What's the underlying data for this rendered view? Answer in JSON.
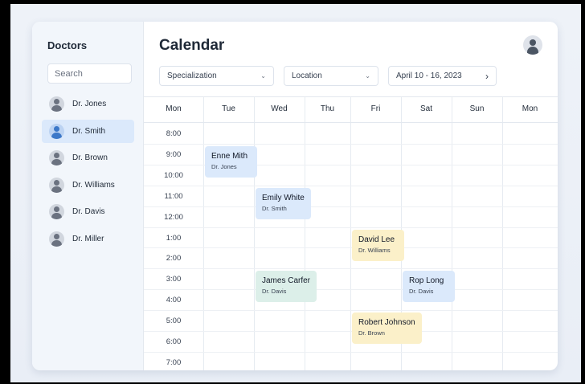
{
  "sidebar": {
    "title": "Doctors",
    "search_placeholder": "Search",
    "doctors": [
      {
        "name": "Dr. Jones",
        "active": false
      },
      {
        "name": "Dr. Smith",
        "active": true
      },
      {
        "name": "Dr. Brown",
        "active": false
      },
      {
        "name": "Dr. Williams",
        "active": false
      },
      {
        "name": "Dr. Davis",
        "active": false
      },
      {
        "name": "Dr. Miller",
        "active": false
      }
    ]
  },
  "header": {
    "title": "Calendar",
    "filters": {
      "specialization": "Specialization",
      "location": "Location",
      "date_range": "April 10 - 16, 2023"
    }
  },
  "calendar": {
    "days": [
      "Mon",
      "Tue",
      "Wed",
      "Thu",
      "Fri",
      "Sat",
      "Sun",
      "Mon"
    ],
    "times": [
      "8:00",
      "9:00",
      "10:00",
      "11:00",
      "12:00",
      "1:00",
      "2:00",
      "3:00",
      "4:00",
      "5:00",
      "6:00",
      "7:00"
    ],
    "appointments": [
      {
        "patient": "Enne Mith",
        "doctor": "Dr. Jones",
        "day_index": 1,
        "time": "9:00",
        "color": "blue"
      },
      {
        "patient": "Emily White",
        "doctor": "Dr. Smith",
        "day_index": 2,
        "time": "11:00",
        "color": "blue"
      },
      {
        "patient": "David Lee",
        "doctor": "Dr. Williams",
        "day_index": 4,
        "time": "1:00",
        "color": "yellow"
      },
      {
        "patient": "James Carfer",
        "doctor": "Dr. Davis",
        "day_index": 2,
        "time": "3:00",
        "color": "green"
      },
      {
        "patient": "Rop Long",
        "doctor": "Dr. Davis",
        "day_index": 5,
        "time": "3:00",
        "color": "blue"
      },
      {
        "patient": "Robert Johnson",
        "doctor": "Dr. Brown",
        "day_index": 4,
        "time": "5:00",
        "color": "yellow"
      }
    ]
  },
  "colors": {
    "accent": "#3c78c8",
    "active_row": "#dbe9fb",
    "appt_blue": "#dbe9fb",
    "appt_green": "#dcefe9",
    "appt_yellow": "#fbf0c9"
  },
  "icons": {
    "user": "user-avatar-icon",
    "dropdown": "chevron-down-icon",
    "next": "chevron-right-icon"
  }
}
